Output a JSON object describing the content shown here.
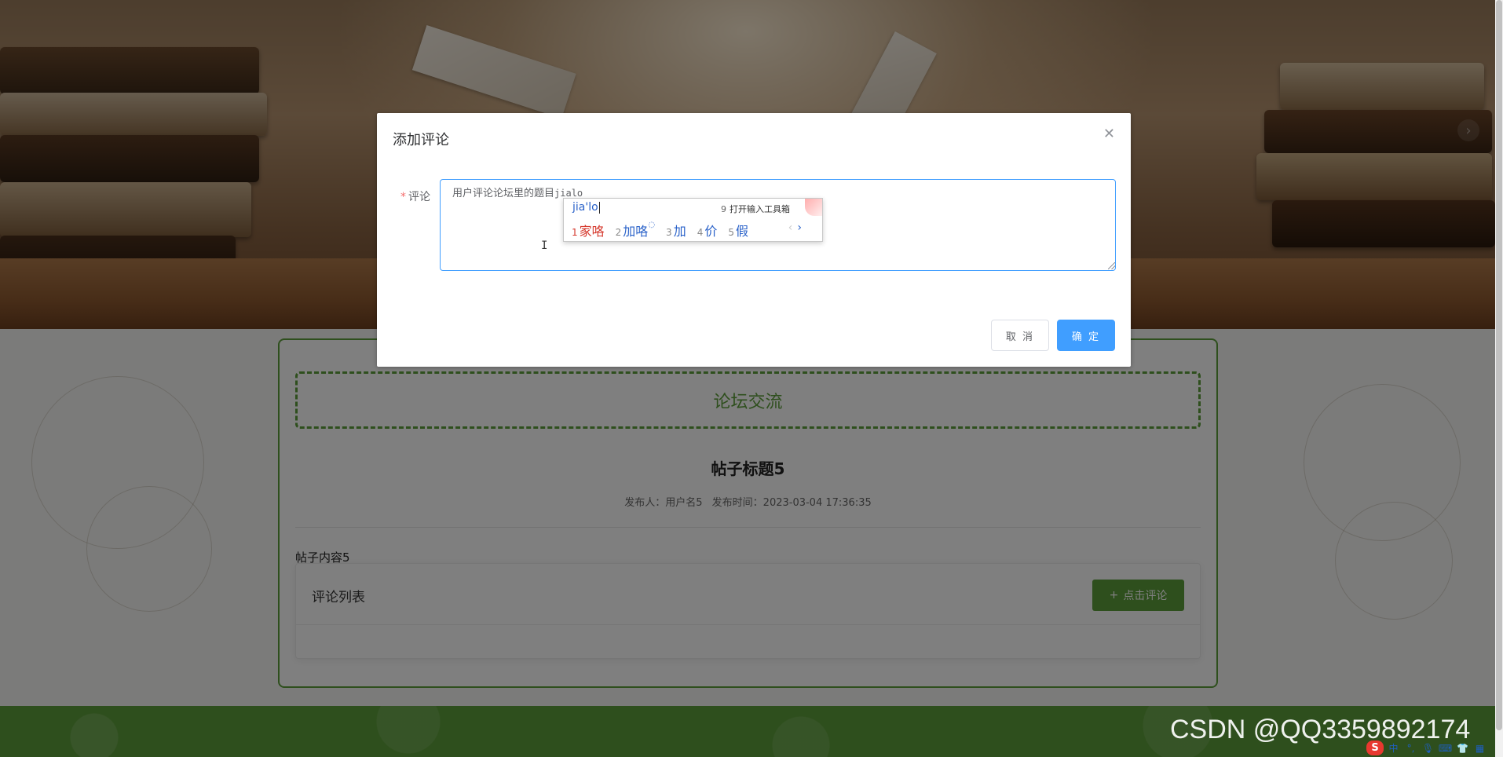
{
  "forum": {
    "section_title": "论坛交流",
    "post_title": "帖子标题5",
    "meta_author_label": "发布人：用户名5",
    "meta_time_label": "发布时间：2023-03-04 17:36:35",
    "post_content": "帖子内容5",
    "comment_list_title": "评论列表",
    "add_comment_label": "点击评论"
  },
  "dialog": {
    "title": "添加评论",
    "field_label": "评论",
    "comment_text": "用户评论论坛里的题目",
    "comment_text_composing": "jialo",
    "cancel_label": "取 消",
    "confirm_label": "确 定"
  },
  "ime": {
    "pinyin": "jia'lo",
    "tool_num": "9",
    "tool_label": "打开输入工具箱",
    "candidates": [
      {
        "num": "1",
        "text": "家咯"
      },
      {
        "num": "2",
        "text": "加咯"
      },
      {
        "num": "3",
        "text": "加"
      },
      {
        "num": "4",
        "text": "价"
      },
      {
        "num": "5",
        "text": "假"
      }
    ]
  },
  "watermark": "CSDN @QQ3359892174",
  "tray": {
    "logo": "S",
    "lang": "中"
  },
  "colors": {
    "brand_green": "#5d9e3a",
    "primary_blue": "#409eff",
    "required_red": "#f56c6c"
  },
  "icons": {
    "close": "close-icon",
    "plus": "plus-icon",
    "carousel_next": "chevron-right-icon",
    "text_cursor": "i-beam-cursor-icon"
  }
}
